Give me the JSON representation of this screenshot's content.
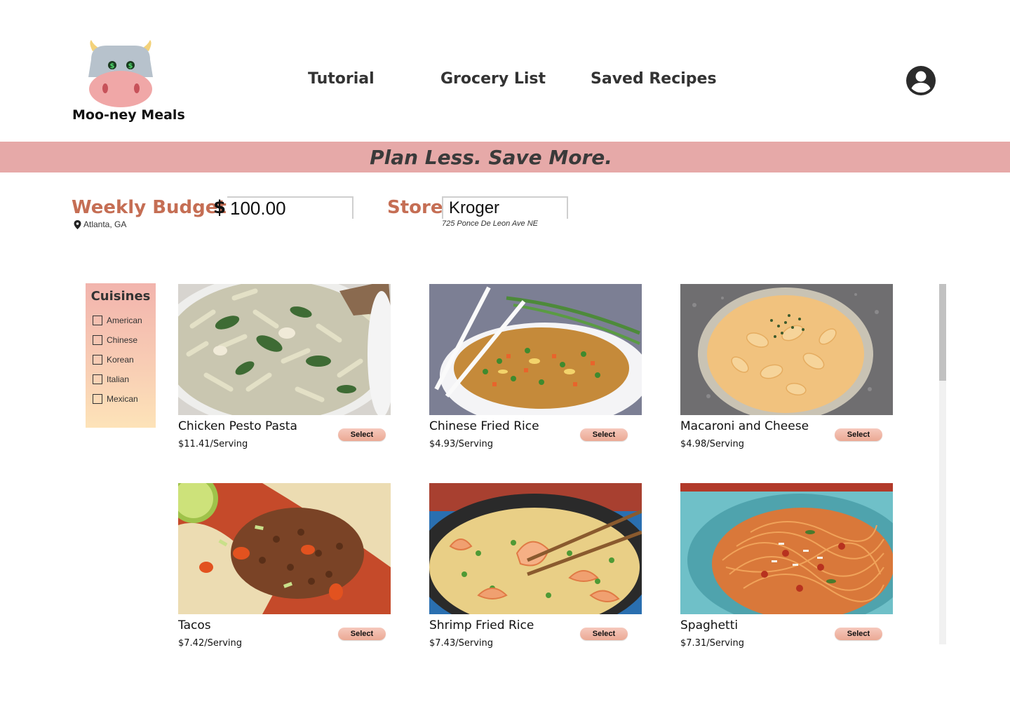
{
  "header": {
    "app_name": "Moo-ney Meals",
    "nav": [
      {
        "label": "Tutorial"
      },
      {
        "label": "Grocery List"
      },
      {
        "label": "Saved Recipes"
      }
    ],
    "profile_icon": "account-circle-icon"
  },
  "banner": {
    "tagline": "Plan Less. Save More."
  },
  "budget": {
    "label": "Weekly Budget:",
    "currency": "$",
    "value": "100.00",
    "location": "Atlanta, GA",
    "location_icon": "map-pin-icon"
  },
  "store": {
    "label": "Store:",
    "value": "Kroger",
    "address": "725 Ponce De Leon Ave NE"
  },
  "cuisines": {
    "title": "Cuisines",
    "items": [
      {
        "label": "American",
        "checked": false
      },
      {
        "label": "Chinese",
        "checked": false
      },
      {
        "label": "Korean",
        "checked": false
      },
      {
        "label": "Italian",
        "checked": false
      },
      {
        "label": "Mexican",
        "checked": false
      }
    ]
  },
  "recipes": [
    {
      "name": "Chicken Pesto Pasta",
      "price": "$11.41/Serving",
      "button": "Select",
      "image": "chicken-pesto-pasta-photo"
    },
    {
      "name": "Chinese Fried Rice",
      "price": "$4.93/Serving",
      "button": "Select",
      "image": "chinese-fried-rice-photo"
    },
    {
      "name": "Macaroni and Cheese",
      "price": "$4.98/Serving",
      "button": "Select",
      "image": "macaroni-and-cheese-photo"
    },
    {
      "name": "Tacos",
      "price": "$7.42/Serving",
      "button": "Select",
      "image": "tacos-photo"
    },
    {
      "name": "Shrimp Fried Rice",
      "price": "$7.43/Serving",
      "button": "Select",
      "image": "shrimp-fried-rice-photo"
    },
    {
      "name": "Spaghetti",
      "price": "$7.31/Serving",
      "button": "Select",
      "image": "spaghetti-photo"
    }
  ],
  "colors": {
    "banner": "#e6a9a8",
    "accent_label": "#c56e54",
    "button": "#eba994"
  }
}
